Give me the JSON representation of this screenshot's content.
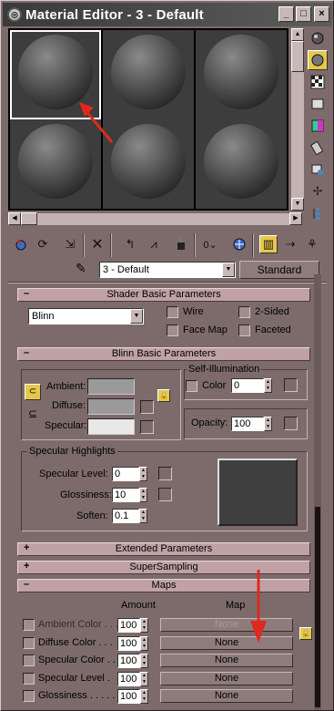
{
  "window": {
    "title": "Material Editor - 3 - Default",
    "btn_minimize": "_",
    "btn_maximize": "□",
    "btn_close": "×"
  },
  "material_slots": {
    "count": 6,
    "selected_index": 0
  },
  "name_row": {
    "material_name": "3 - Default",
    "type_button": "Standard"
  },
  "shader_basic": {
    "title": "Shader Basic Parameters",
    "toggle": "–",
    "shader": "Blinn",
    "wire": "Wire",
    "two_sided": "2-Sided",
    "face_map": "Face Map",
    "faceted": "Faceted"
  },
  "blinn_basic": {
    "title": "Blinn Basic Parameters",
    "toggle": "–",
    "ambient": "Ambient:",
    "diffuse": "Diffuse:",
    "specular": "Specular:",
    "self_illum_title": "Self-Illumination",
    "color_label": "Color",
    "color_value": "0",
    "opacity_label": "Opacity:",
    "opacity_value": "100",
    "spec_title": "Specular Highlights",
    "spec_level_label": "Specular Level:",
    "spec_level_value": "0",
    "glossiness_label": "Glossiness:",
    "glossiness_value": "10",
    "soften_label": "Soften:",
    "soften_value": "0.1"
  },
  "extended": {
    "title": "Extended Parameters",
    "toggle": "+"
  },
  "supersampling": {
    "title": "SuperSampling",
    "toggle": "+"
  },
  "maps": {
    "title": "Maps",
    "toggle": "–",
    "col_amount": "Amount",
    "col_map": "Map",
    "rows": [
      {
        "label": "Ambient Color . . .",
        "amount": "100",
        "map": "None",
        "disabled": true
      },
      {
        "label": "Diffuse Color . . .",
        "amount": "100",
        "map": "None",
        "disabled": false
      },
      {
        "label": "Specular Color . . .",
        "amount": "100",
        "map": "None",
        "disabled": false
      },
      {
        "label": "Specular Level  .",
        "amount": "100",
        "map": "None",
        "disabled": false
      },
      {
        "label": "Glossiness  . . . . .",
        "amount": "100",
        "map": "None",
        "disabled": false
      }
    ]
  },
  "colors": {
    "annotation_arrow": "#e0281e",
    "rollout_header": "#c0a2a6",
    "active_tool": "#e6c84a"
  }
}
